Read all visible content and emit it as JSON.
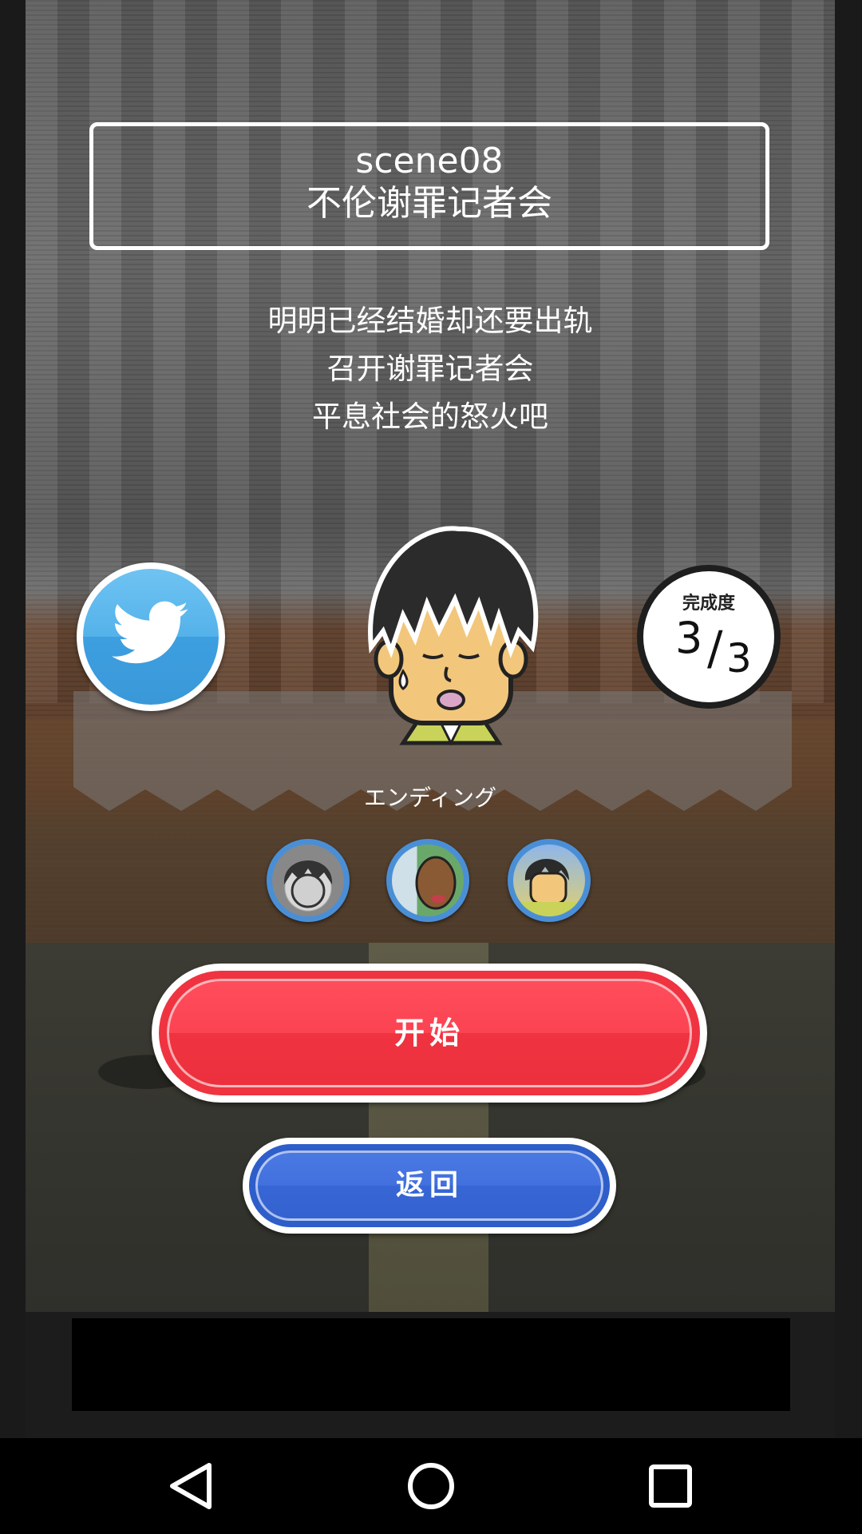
{
  "scene": {
    "code": "scene08",
    "title": "不伦谢罪记者会"
  },
  "description": [
    "明明已经结婚却还要出轨",
    "召开谢罪记者会",
    "平息社会的怒火吧"
  ],
  "progress": {
    "label": "完成度",
    "current": "3",
    "slash": "/",
    "total": "3"
  },
  "character": {
    "ending_label": "エンディング"
  },
  "endings": [
    {
      "icon": "ending-thumb-1"
    },
    {
      "icon": "ending-thumb-2"
    },
    {
      "icon": "ending-thumb-3"
    }
  ],
  "buttons": {
    "start": "开始",
    "back": "返回",
    "share": "twitter-icon"
  },
  "colors": {
    "start": "#ef3340",
    "back": "#3766d5",
    "twitter": "#54b2ea"
  },
  "navbar": {
    "back": "back-triangle-icon",
    "home": "home-circle-icon",
    "recents": "recents-square-icon"
  }
}
